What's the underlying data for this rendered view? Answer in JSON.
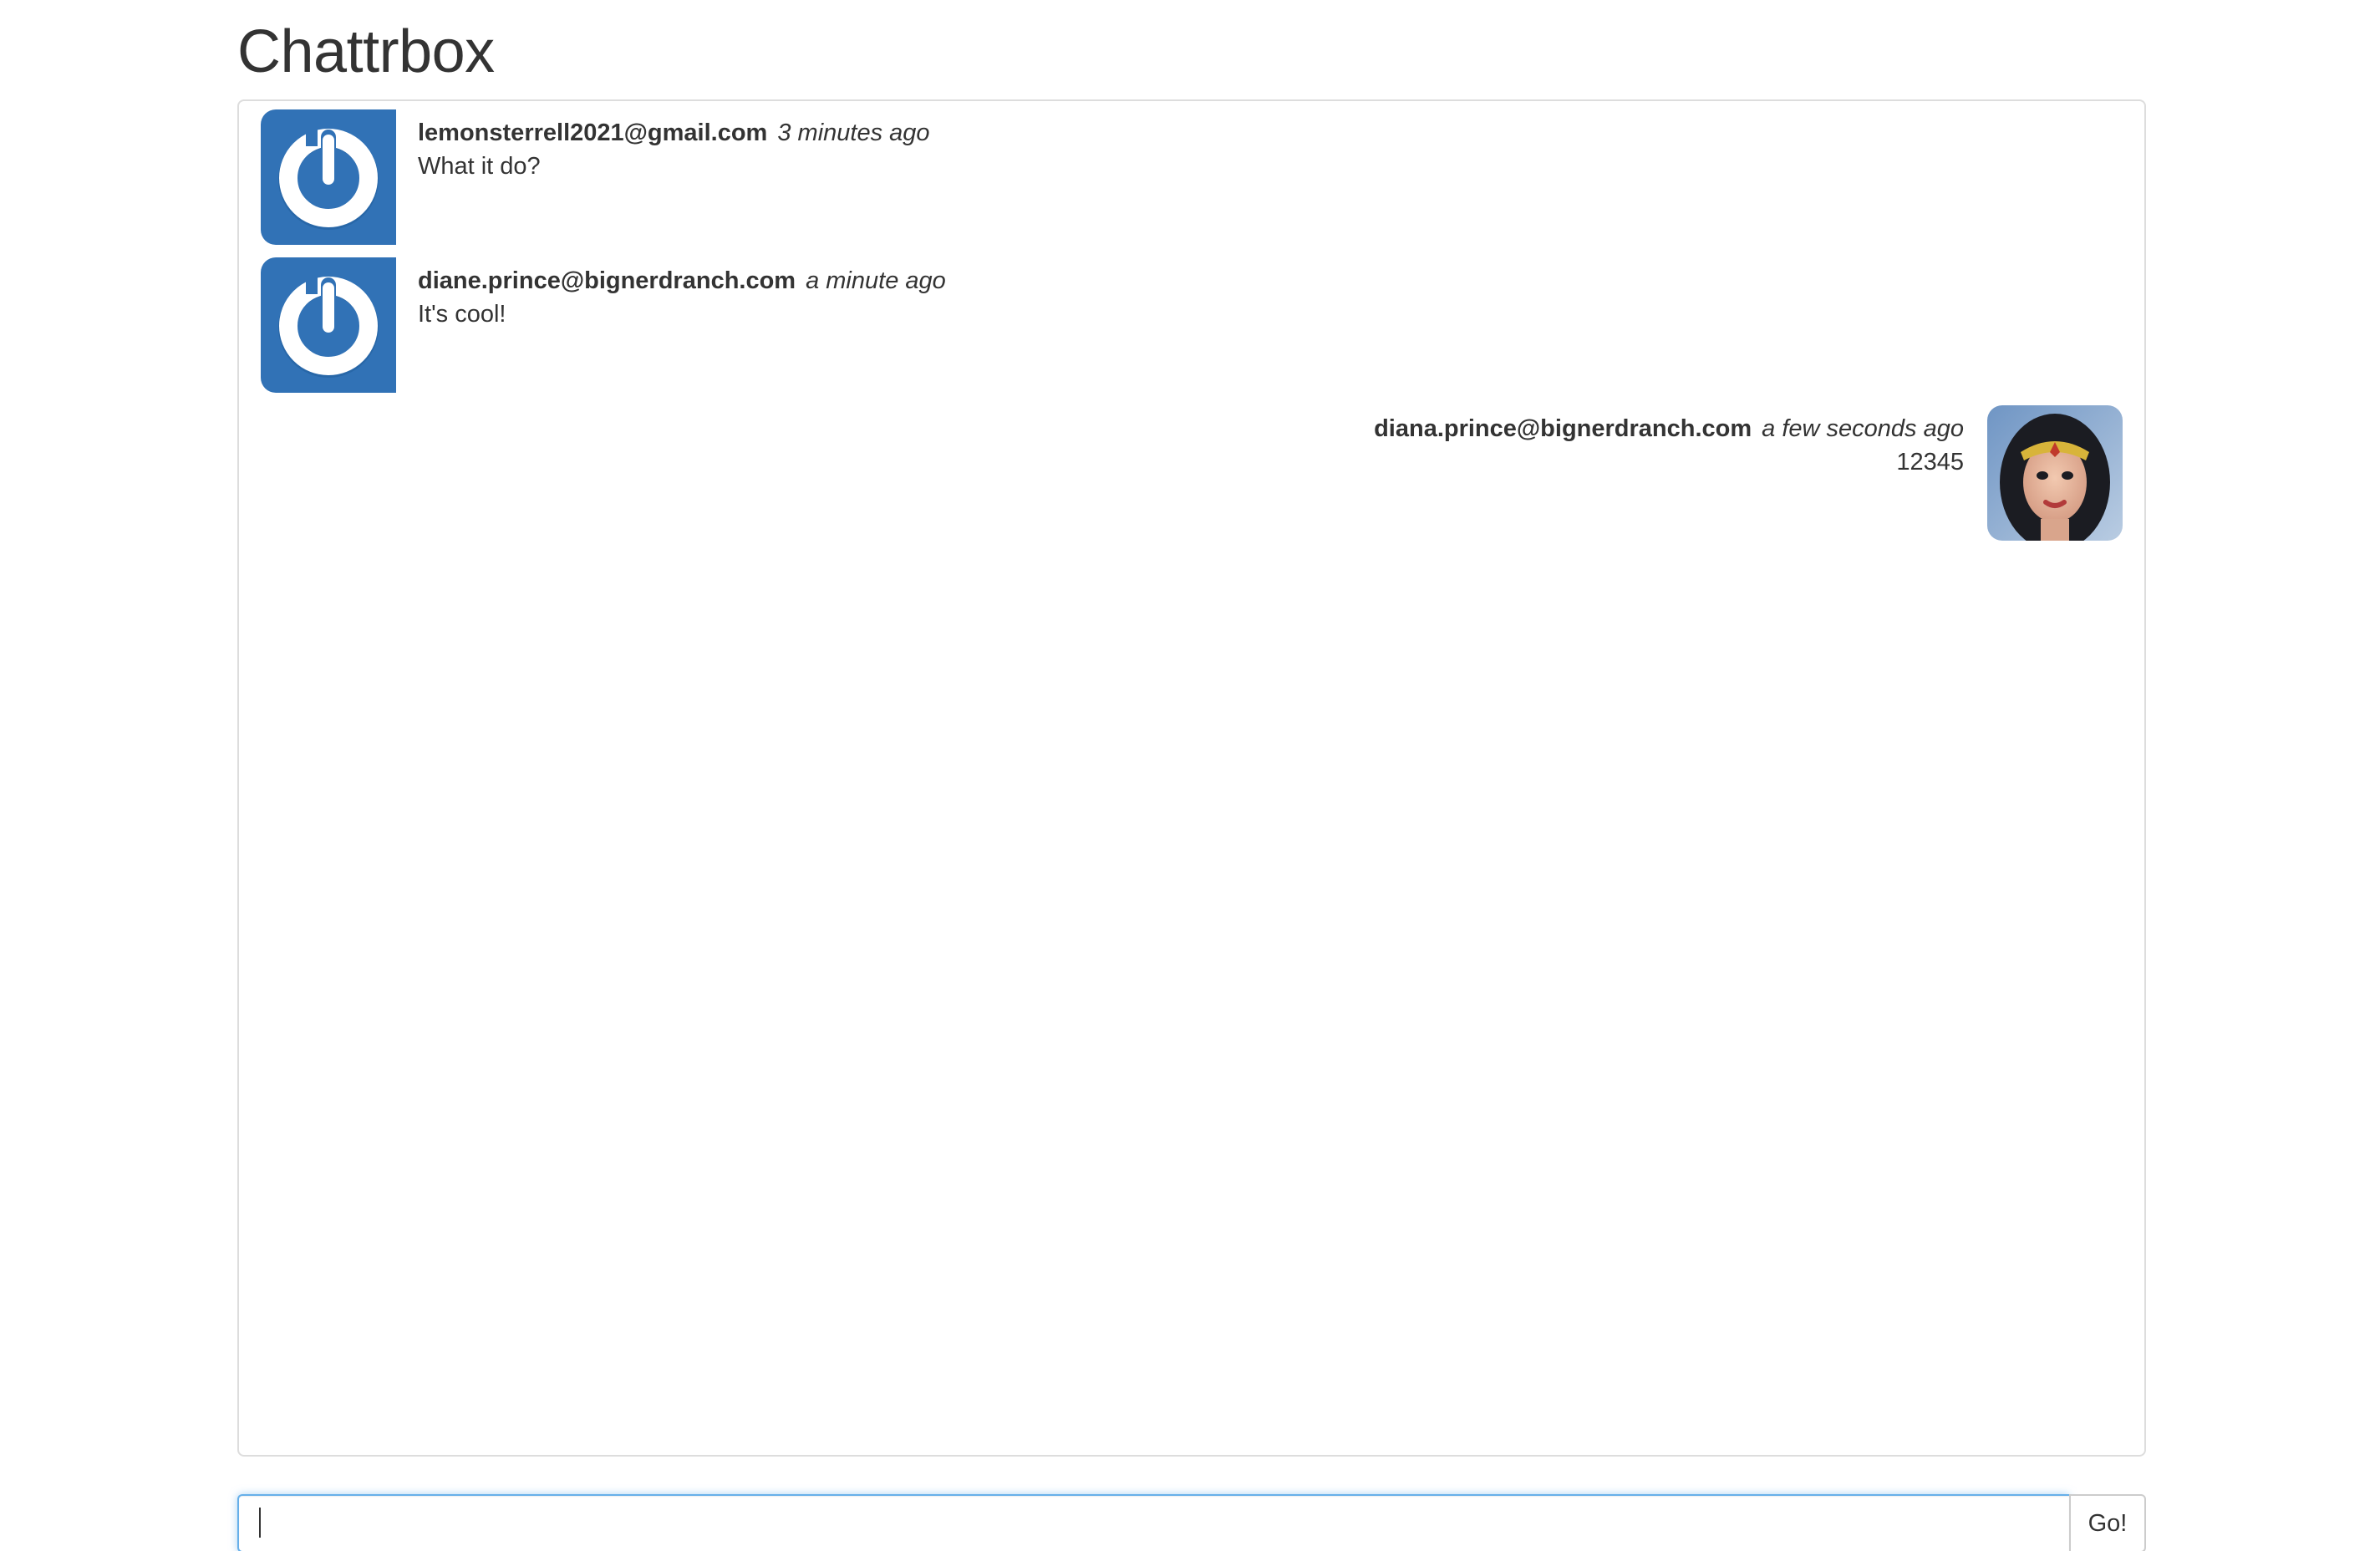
{
  "app": {
    "title": "Chattrbox"
  },
  "messages": [
    {
      "sender": "lemonsterrell2021@gmail.com",
      "time": "3 minutes ago",
      "text": "What it do?",
      "avatar": "gravatar-default-icon",
      "align": "left"
    },
    {
      "sender": "diane.prince@bignerdranch.com",
      "time": "a minute ago",
      "text": "It's cool!",
      "avatar": "gravatar-default-icon",
      "align": "left"
    },
    {
      "sender": "diana.prince@bignerdranch.com",
      "time": "a few seconds ago",
      "text": "12345",
      "avatar": "user-photo-avatar",
      "align": "right"
    }
  ],
  "composer": {
    "value": "",
    "placeholder": "",
    "button_label": "Go!"
  },
  "colors": {
    "gravatar_blue": "#3172b6",
    "border": "#dddddd",
    "focus_ring": "#66afe9"
  }
}
